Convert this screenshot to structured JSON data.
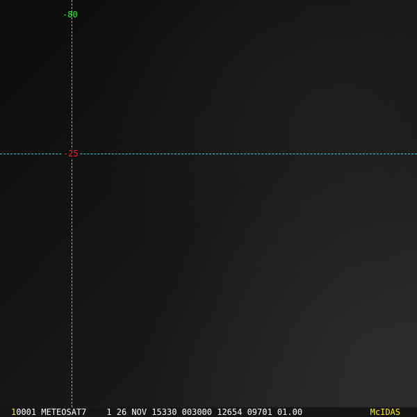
{
  "overlay": {
    "lat_label": "-80",
    "lon_label": "-25",
    "grid_color": "#3ad8e8",
    "lat_label_color": "#33ee33",
    "lon_label_color": "#ff2222"
  },
  "status_bar": {
    "frame": "1",
    "info": "0001 METEOSAT7    1 26 NOV 15330 003000 12654 09701 01.00",
    "brand": "McIDAS"
  }
}
